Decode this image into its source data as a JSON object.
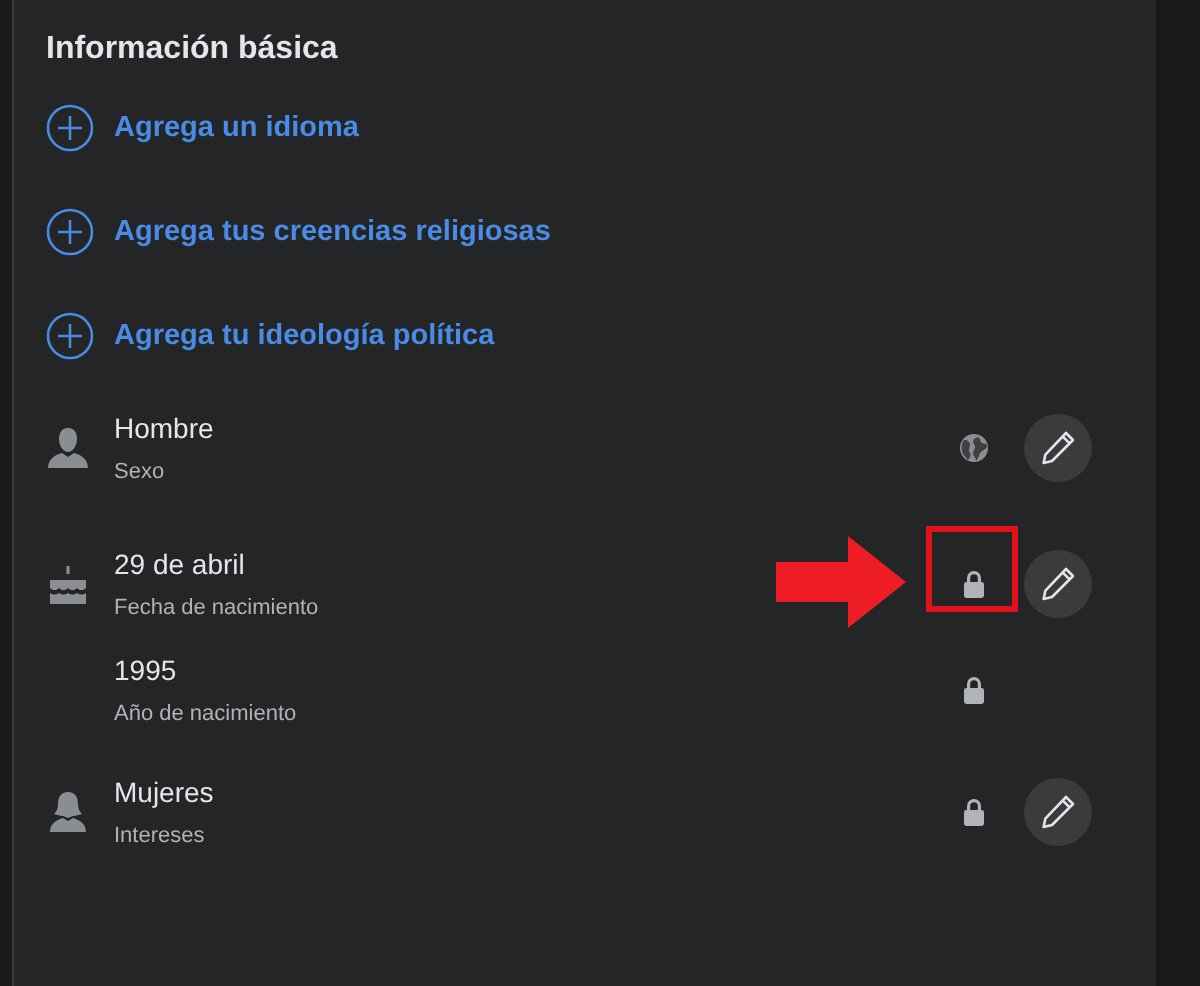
{
  "heading": "Información básica",
  "add_links": [
    {
      "label": "Agrega un idioma"
    },
    {
      "label": "Agrega tus creencias religiosas"
    },
    {
      "label": "Agrega tu ideología política"
    }
  ],
  "details": [
    {
      "kind": "person",
      "value": "Hombre",
      "caption": "Sexo",
      "locked": false,
      "editable": true,
      "highlighted": false
    },
    {
      "kind": "birthday",
      "value": "29 de abril",
      "caption": "Fecha de nacimiento",
      "locked": true,
      "editable": true,
      "highlighted": true
    },
    {
      "kind": "year",
      "value": "1995",
      "caption": "Año de nacimiento",
      "locked": true,
      "editable": false,
      "highlighted": false
    },
    {
      "kind": "interest",
      "value": "Mujeres",
      "caption": "Intereses",
      "locked": true,
      "editable": true,
      "highlighted": false
    }
  ]
}
